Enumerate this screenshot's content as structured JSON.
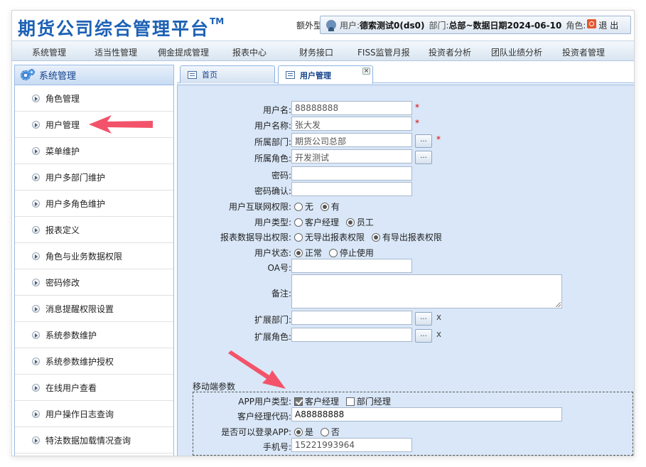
{
  "header": {
    "logo": "期货公司综合管理平台",
    "logo_tm": "TM",
    "quota": "额外型",
    "user_label": "用户:",
    "user_value": "德索测试0(ds0)",
    "dept_label": "部门:",
    "dept_value": "总部~数据日期2024-06-10",
    "role_label": "角色:",
    "logout": "退 出"
  },
  "nav": [
    "系统管理",
    "适当性管理",
    "佣金提成管理",
    "报表中心",
    "财务接口",
    "FISS监管月报",
    "投资者分析",
    "团队业绩分析",
    "投资者管理"
  ],
  "sidebar": {
    "title": "系统管理",
    "items": [
      "角色管理",
      "用户管理",
      "菜单维护",
      "用户多部门维护",
      "用户多角色维护",
      "报表定义",
      "角色与业务数据权限",
      "密码修改",
      "消息提醒权限设置",
      "系统参数维护",
      "系统参数维护授权",
      "在线用户查看",
      "用户操作日志查询",
      "特法数据加载情况查询"
    ]
  },
  "tabs": [
    {
      "label": "首页"
    },
    {
      "label": "用户管理",
      "close": "×"
    }
  ],
  "form": {
    "labels": {
      "username": "用户名:",
      "fullname": "用户名称:",
      "dept": "所属部门:",
      "role": "所属角色:",
      "password": "密码:",
      "password_confirm": "密码确认:",
      "internet": "用户互联网权限:",
      "user_type": "用户类型:",
      "export": "报表数据导出权限:",
      "status": "用户状态:",
      "oa": "OA号:",
      "remark": "备注:",
      "ext_dept": "扩展部门:",
      "ext_role": "扩展角色:"
    },
    "values": {
      "username": "88888888",
      "fullname": "张大发",
      "dept": "期货公司总部",
      "role": "开发测试",
      "password": "",
      "password_confirm": "",
      "oa": "",
      "ext_dept": "",
      "ext_role": ""
    },
    "required_mark": "*",
    "dots": "...",
    "x": "x",
    "internet_options": [
      "无",
      "有"
    ],
    "user_type_options": [
      "客户经理",
      "员工"
    ],
    "export_options": [
      "无导出报表权限",
      "有导出报表权限"
    ],
    "status_options": [
      "正常",
      "停止使用"
    ]
  },
  "mobile": {
    "title": "移动端参数",
    "labels": {
      "app_type": "APP用户类型:",
      "manager_code": "客户经理代码:",
      "can_login": "是否可以登录APP:",
      "phone": "手机号:"
    },
    "app_type_options": [
      "客户经理",
      "部门经理"
    ],
    "manager_code": "A88888888",
    "can_login_options": [
      "是",
      "否"
    ],
    "phone": "15221993964"
  },
  "colors": {
    "accent": "#1d61b5",
    "content_bg": "#d9e7f8",
    "arrow": "#f2536a"
  }
}
